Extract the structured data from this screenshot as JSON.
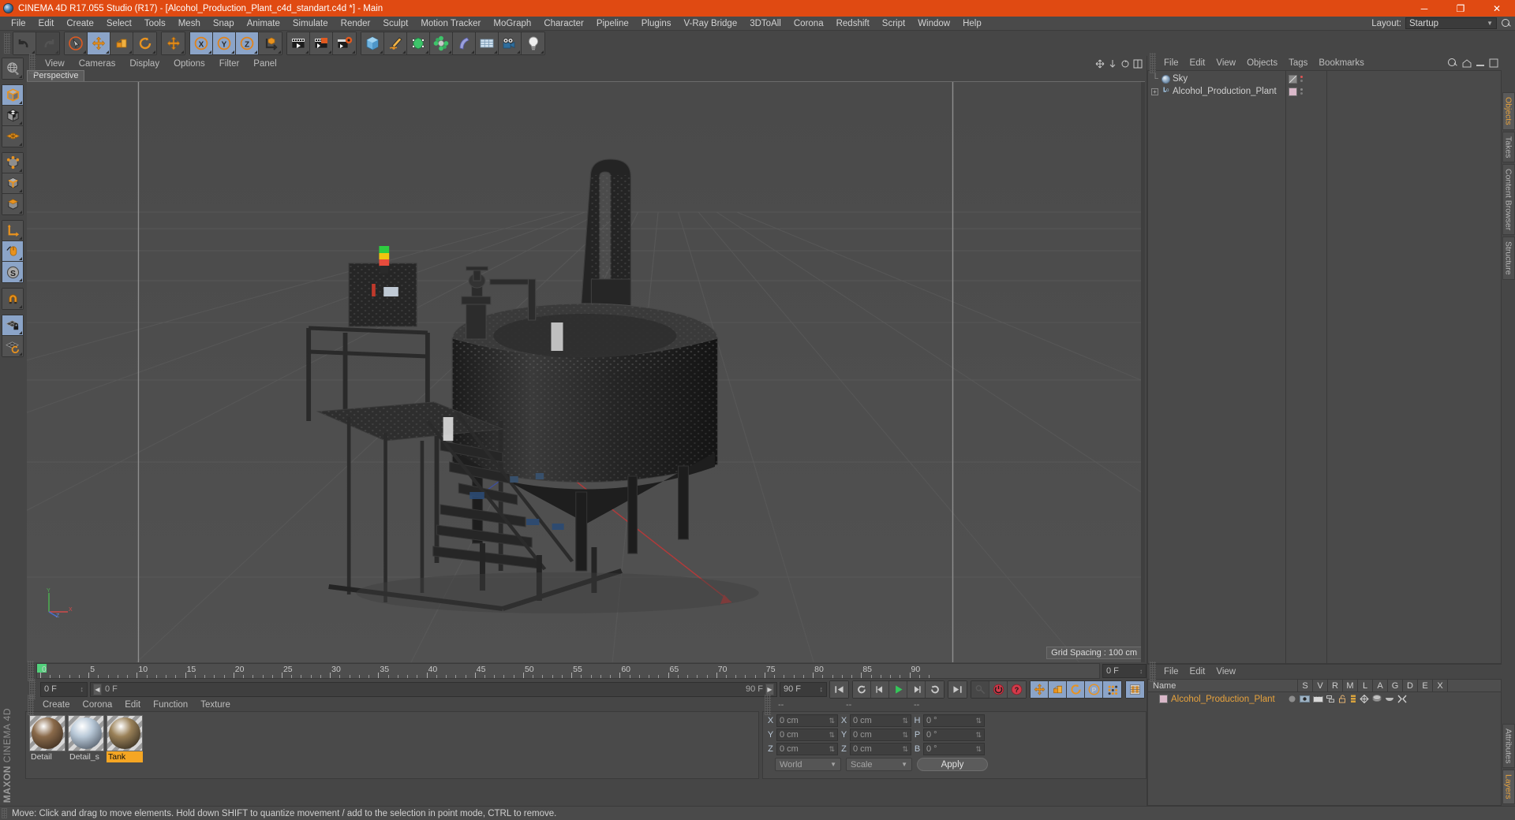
{
  "titlebar": {
    "title": "CINEMA 4D R17.055 Studio (R17) - [Alcohol_Production_Plant_c4d_standart.c4d *] - Main",
    "minimize": "─",
    "maximize": "❐",
    "close": "✕"
  },
  "menubar": {
    "items": [
      "File",
      "Edit",
      "Create",
      "Select",
      "Tools",
      "Mesh",
      "Snap",
      "Animate",
      "Simulate",
      "Render",
      "Sculpt",
      "Motion Tracker",
      "MoGraph",
      "Character",
      "Pipeline",
      "Plugins",
      "V-Ray Bridge",
      "3DToAll",
      "Corona",
      "Redshift",
      "Script",
      "Window",
      "Help"
    ],
    "layout_label": "Layout:",
    "layout_value": "Startup"
  },
  "toolbar": {
    "groups": [
      {
        "buttons": [
          {
            "name": "undo-button",
            "icon": "undo",
            "state": "normal"
          },
          {
            "name": "redo-button",
            "icon": "redo",
            "state": "disabled"
          }
        ]
      },
      {
        "buttons": [
          {
            "name": "live-selection-tool",
            "icon": "cursor-circle",
            "state": "normal"
          },
          {
            "name": "move-tool",
            "icon": "move",
            "state": "active"
          },
          {
            "name": "scale-tool",
            "icon": "scale",
            "state": "normal"
          },
          {
            "name": "rotate-tool",
            "icon": "rotate",
            "state": "normal"
          }
        ]
      },
      {
        "buttons": [
          {
            "name": "move-duplicate-tool",
            "icon": "move",
            "state": "normal"
          }
        ]
      },
      {
        "buttons": [
          {
            "name": "x-axis-lock",
            "icon": "axis-x",
            "state": "active"
          },
          {
            "name": "y-axis-lock",
            "icon": "axis-y",
            "state": "active"
          },
          {
            "name": "z-axis-lock",
            "icon": "axis-z",
            "state": "active"
          },
          {
            "name": "world-object-coordinate",
            "icon": "world-axis",
            "state": "normal"
          }
        ]
      },
      {
        "buttons": [
          {
            "name": "render-view-button",
            "icon": "render-view",
            "state": "normal"
          },
          {
            "name": "render-region-button",
            "icon": "render-region",
            "state": "normal"
          },
          {
            "name": "render-settings-button",
            "icon": "render-settings",
            "state": "normal"
          }
        ]
      },
      {
        "buttons": [
          {
            "name": "primitive-cube-button",
            "icon": "cube-blue",
            "state": "normal"
          },
          {
            "name": "spline-pen-button",
            "icon": "pen",
            "state": "normal"
          },
          {
            "name": "generator-button",
            "icon": "nurbs-green",
            "state": "normal"
          },
          {
            "name": "array-button",
            "icon": "array-green",
            "state": "normal"
          },
          {
            "name": "deformer-button",
            "icon": "bend",
            "state": "normal"
          },
          {
            "name": "scene-floor-button",
            "icon": "floor-grid",
            "state": "normal"
          },
          {
            "name": "camera-button",
            "icon": "camera",
            "state": "normal"
          },
          {
            "name": "light-button",
            "icon": "light-bulb",
            "state": "normal"
          }
        ]
      }
    ]
  },
  "leftbar": {
    "groups": [
      {
        "buttons": [
          {
            "name": "make-editable-button",
            "icon": "globe-editable",
            "state": "normal"
          }
        ]
      },
      {
        "buttons": [
          {
            "name": "model-mode-button",
            "icon": "cube-orange-outline",
            "state": "active"
          },
          {
            "name": "texture-mode-button",
            "icon": "cube-checker",
            "state": "normal"
          },
          {
            "name": "uv-mode-button",
            "icon": "grid-orange",
            "state": "normal"
          }
        ]
      },
      {
        "buttons": [
          {
            "name": "points-mode-button",
            "icon": "cube-points",
            "state": "normal"
          },
          {
            "name": "edges-mode-button",
            "icon": "cube-edges",
            "state": "normal"
          },
          {
            "name": "polygons-mode-button",
            "icon": "cube-polys",
            "state": "normal"
          }
        ]
      },
      {
        "buttons": [
          {
            "name": "object-axis-mode-button",
            "icon": "axis-l",
            "state": "normal"
          },
          {
            "name": "enable-axis-button",
            "icon": "mouse",
            "state": "active"
          },
          {
            "name": "soft-selection-button",
            "icon": "s-circle",
            "state": "active"
          }
        ]
      },
      {
        "buttons": [
          {
            "name": "magnet-tool-button",
            "icon": "magnet",
            "state": "normal"
          }
        ]
      },
      {
        "buttons": [
          {
            "name": "workplane-lock-button",
            "icon": "grid-lock",
            "state": "active"
          },
          {
            "name": "workplane-rotate-button",
            "icon": "grid-rotate",
            "state": "normal"
          }
        ]
      }
    ],
    "brand_top": "MAXON",
    "brand_bottom": "CINEMA 4D"
  },
  "viewport": {
    "menu": [
      "View",
      "Cameras",
      "Display",
      "Options",
      "Filter",
      "Panel"
    ],
    "tab": "Perspective",
    "grid_spacing": "Grid Spacing : 100 cm",
    "axis_labels": {
      "x": "X",
      "y": "Y",
      "z": "Z"
    }
  },
  "timeline": {
    "ticks": [
      0,
      5,
      10,
      15,
      20,
      25,
      30,
      35,
      40,
      45,
      50,
      55,
      60,
      65,
      70,
      75,
      80,
      85,
      90
    ],
    "current_frame_field": "0 F",
    "start_field": "0 F",
    "range_start": "0 F",
    "range_end": "90 F",
    "end_field": "90 F",
    "transport_buttons": [
      {
        "name": "go-to-start-button",
        "icon": "skip-start"
      },
      {
        "name": "play-backwards-button",
        "icon": "rewind-loop"
      },
      {
        "name": "previous-frame-button",
        "icon": "step-back"
      },
      {
        "name": "play-forward-button",
        "icon": "play"
      },
      {
        "name": "next-frame-button",
        "icon": "step-forward"
      },
      {
        "name": "play-loop-button",
        "icon": "loop"
      },
      {
        "name": "go-to-end-button",
        "icon": "skip-end"
      },
      {
        "name": "record-active-objects-button",
        "icon": "key-disabled"
      },
      {
        "name": "autokeying-button",
        "icon": "power-red"
      },
      {
        "name": "keyframe-selection-button",
        "icon": "question-red"
      },
      {
        "name": "position-key-button",
        "icon": "move"
      },
      {
        "name": "scale-key-button",
        "icon": "scale"
      },
      {
        "name": "rotation-key-button",
        "icon": "rotate"
      },
      {
        "name": "parameter-key-button",
        "icon": "p-circle"
      },
      {
        "name": "point-level-animation-button",
        "icon": "dots-grid"
      },
      {
        "name": "timeline-panel-button",
        "icon": "timeline-strip"
      }
    ]
  },
  "materials": {
    "menu": [
      "Create",
      "Corona",
      "Edit",
      "Function",
      "Texture"
    ],
    "items": [
      {
        "name": "Detail",
        "selected": false,
        "color1": "#8a6a4a",
        "color2": "#2a1f16"
      },
      {
        "name": "Detail_s",
        "selected": false,
        "color1": "#b9c9d8",
        "color2": "#39414c"
      },
      {
        "name": "Tank",
        "selected": true,
        "color1": "#9a8158",
        "color2": "#1e1a14"
      }
    ]
  },
  "coordinates": {
    "header": [
      "--",
      "--",
      "--"
    ],
    "rows": [
      {
        "l1": "X",
        "v1": "0 cm",
        "l2": "X",
        "v2": "0 cm",
        "l3": "H",
        "v3": "0 °"
      },
      {
        "l1": "Y",
        "v1": "0 cm",
        "l2": "Y",
        "v2": "0 cm",
        "l3": "P",
        "v3": "0 °"
      },
      {
        "l1": "Z",
        "v1": "0 cm",
        "l2": "Z",
        "v2": "0 cm",
        "l3": "B",
        "v3": "0 °"
      }
    ],
    "coord_system": "World",
    "size_mode": "Scale",
    "apply_label": "Apply"
  },
  "object_manager": {
    "menu": [
      "File",
      "Edit",
      "View",
      "Objects",
      "Tags",
      "Bookmarks"
    ],
    "objects": [
      {
        "name": "Sky",
        "icon": "sky-sphere-icon",
        "expandable": false,
        "tag_color": "#7d7d7d",
        "dot_color": "#e05555"
      },
      {
        "name": "Alcohol_Production_Plant",
        "icon": "null-object-icon",
        "expandable": true,
        "tag_color": "#d9b8c9",
        "dot_color": "#8a8a8a"
      }
    ]
  },
  "attributes": {
    "menu": [
      "File",
      "Edit",
      "View"
    ],
    "columns": [
      "Name",
      "S",
      "V",
      "R",
      "M",
      "L",
      "A",
      "G",
      "D",
      "E",
      "X"
    ],
    "rows": [
      {
        "name": "Alcohol_Production_Plant",
        "swatch": "#d9b8c9"
      }
    ]
  },
  "vtabs": {
    "top": [
      "Objects",
      "Takes",
      "Content Browser",
      "Structure"
    ],
    "bottom": [
      "Attributes",
      "Layers"
    ],
    "active_top": "Objects",
    "active_bottom": "Layers"
  },
  "statusbar": {
    "message": "Move: Click and drag to move elements. Hold down SHIFT to quantize movement / add to the selection in point mode, CTRL to remove."
  }
}
